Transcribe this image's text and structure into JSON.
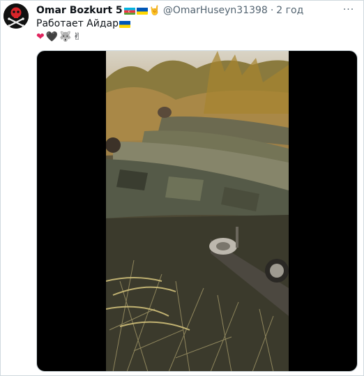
{
  "tweet": {
    "display_name": "Omar Bozkurt 5",
    "handle": "@OmarHuseyn31398",
    "separator": "·",
    "time": "2 год",
    "text": "Работает Айдар",
    "more_label": "···"
  },
  "icons": {
    "avatar": "pirate-skull-avatar",
    "flag_az": "azerbaijan-flag-icon",
    "flag_ua": "ukraine-flag-icon",
    "hand_sign": "horns-hand-icon",
    "heart_red": "red-heart-icon",
    "heart_black": "black-heart-icon",
    "wolf": "wolf-icon",
    "victory_hand": "victory-hand-icon",
    "more": "more-horizontal-icon"
  },
  "emoji": {
    "horns": "🤘",
    "red_heart": "❤",
    "black_heart": "🖤",
    "wolf": "🐺",
    "victory": "✌"
  },
  "colors": {
    "text_primary": "#0f1419",
    "text_secondary": "#536471",
    "border": "#cfd9de",
    "media_bg": "#000000",
    "avatar_bg": "#111111",
    "avatar_accent": "#d9252a"
  }
}
